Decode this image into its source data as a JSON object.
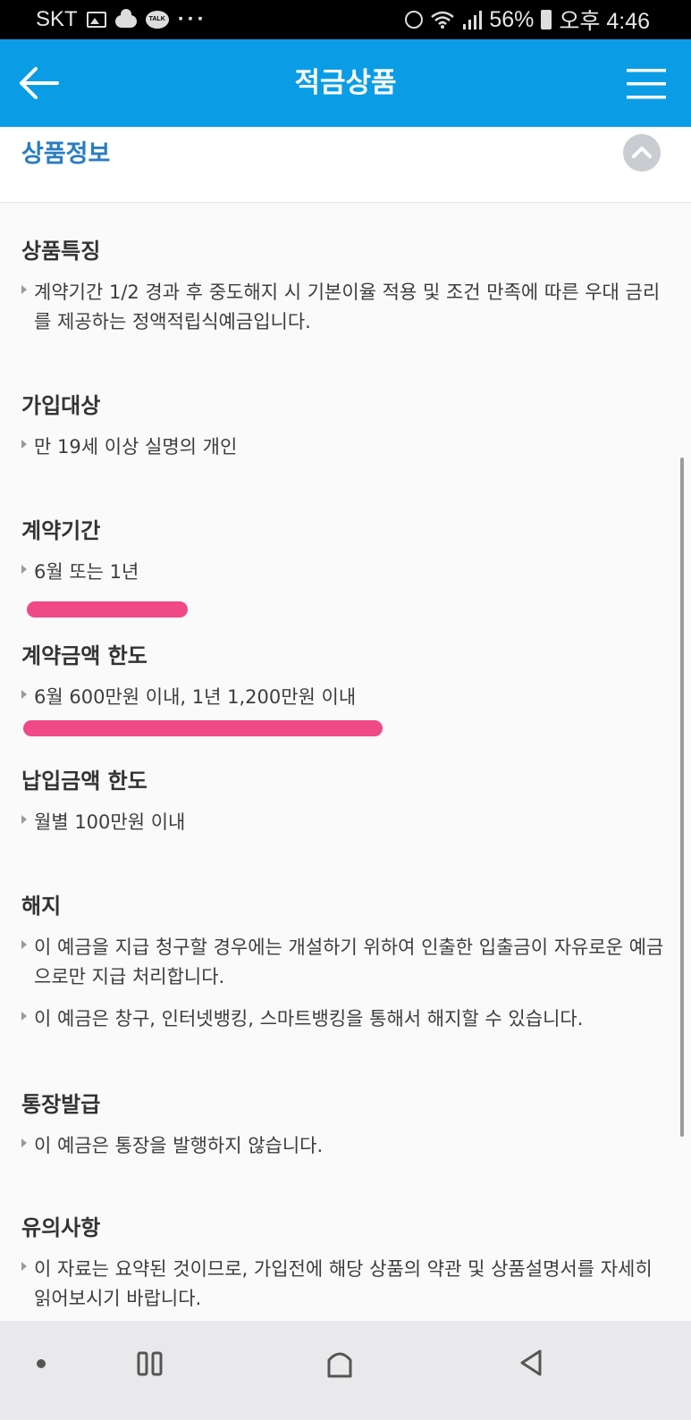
{
  "status_bar": {
    "carrier": "SKT",
    "battery": "56%",
    "time": "오후 4:46",
    "talk_badge": "TALK",
    "more": "···"
  },
  "header": {
    "title": "적금상품"
  },
  "section": {
    "title": "상품정보"
  },
  "blocks": [
    {
      "heading": "상품특징",
      "bullets": [
        "계약기간 1/2 경과 후 중도해지 시 기본이율 적용 및 조건 만족에 따른 우대 금리를 제공하는 정액적립식예금입니다."
      ]
    },
    {
      "heading": "가입대상",
      "bullets": [
        "만 19세 이상 실명의 개인"
      ]
    },
    {
      "heading": "계약기간",
      "bullets": [
        "6월 또는 1년"
      ]
    },
    {
      "heading": "계약금액 한도",
      "bullets": [
        "6월 600만원 이내, 1년 1,200만원 이내"
      ]
    },
    {
      "heading": "납입금액 한도",
      "bullets": [
        "월별 100만원 이내"
      ]
    },
    {
      "heading": "해지",
      "bullets": [
        "이 예금을 지급 청구할 경우에는 개설하기 위하여 인출한 입출금이 자유로운 예금으로만 지급 처리합니다.",
        "이 예금은 창구, 인터넷뱅킹, 스마트뱅킹을 통해서 해지할 수 있습니다."
      ]
    },
    {
      "heading": "통장발급",
      "bullets": [
        "이 예금은 통장을 발행하지 않습니다."
      ]
    },
    {
      "heading": "유의사항",
      "bullets": [
        "이 자료는 요약된 것이므로, 가입전에 해당 상품의 약관 및 상품설명서를 자세히 읽어보시기 바랍니다."
      ]
    }
  ],
  "colors": {
    "header_bg": "#0a9de6",
    "section_title": "#2a7cc2",
    "highlight": "#ee3f7f"
  },
  "icons": [
    "back-arrow-icon",
    "hamburger-menu-icon",
    "chevron-up-icon",
    "recent-apps-icon",
    "home-icon",
    "back-icon"
  ]
}
